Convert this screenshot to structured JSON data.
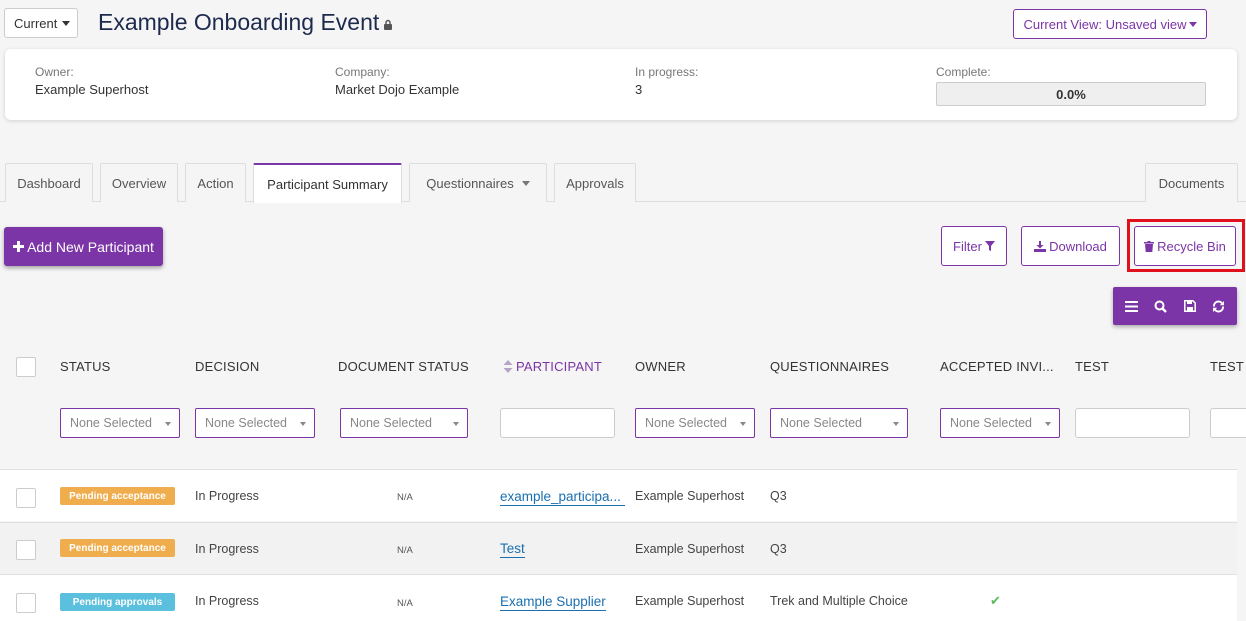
{
  "header": {
    "version_select": "Current",
    "title": "Example Onboarding Event",
    "current_view": "Current View: Unsaved view"
  },
  "summary": {
    "owner_label": "Owner:",
    "owner_value": "Example Superhost",
    "company_label": "Company:",
    "company_value": "Market Dojo Example",
    "in_progress_label": "In progress:",
    "in_progress_value": "3",
    "complete_label": "Complete:",
    "complete_value": "0.0%",
    "complete_fraction": 0.0
  },
  "tabs": [
    {
      "label": "Dashboard"
    },
    {
      "label": "Overview"
    },
    {
      "label": "Action"
    },
    {
      "label": "Participant Summary",
      "active": true
    },
    {
      "label": "Questionnaires"
    },
    {
      "label": "Approvals"
    },
    {
      "label": "Documents"
    }
  ],
  "actions": {
    "add_participant": "Add New Participant",
    "filter": "Filter",
    "download": "Download",
    "recycle_bin": "Recycle Bin"
  },
  "toolbar": {
    "icons": [
      "menu-icon",
      "search-icon",
      "save-icon",
      "refresh-icon"
    ]
  },
  "table": {
    "columns": [
      "STATUS",
      "DECISION",
      "DOCUMENT STATUS",
      "PARTICIPANT",
      "OWNER",
      "QUESTIONNAIRES",
      "ACCEPTED INVI...",
      "TEST",
      "TEST"
    ],
    "filter_placeholder": "None Selected",
    "rows": [
      {
        "status": "Pending acceptance",
        "decision": "In Progress",
        "document_status": "N/A",
        "participant": "example_participa...",
        "owner": "Example Superhost",
        "questionnaires": "Q3",
        "accepted": ""
      },
      {
        "status": "Pending acceptance",
        "decision": "In Progress",
        "document_status": "N/A",
        "participant": "Test",
        "owner": "Example Superhost",
        "questionnaires": "Q3",
        "accepted": ""
      },
      {
        "status": "Pending approvals",
        "decision": "In Progress",
        "document_status": "N/A",
        "participant": "Example Supplier",
        "owner": "Example Superhost",
        "questionnaires": "Trek and Multiple Choice",
        "accepted": "✔"
      }
    ]
  },
  "colors": {
    "brand": "#7b35a6",
    "link": "#1a6fb0",
    "badge_orange": "#f0ad4e",
    "badge_blue": "#5bc0de",
    "highlight": "#e0101c",
    "check": "#5cb85c"
  }
}
